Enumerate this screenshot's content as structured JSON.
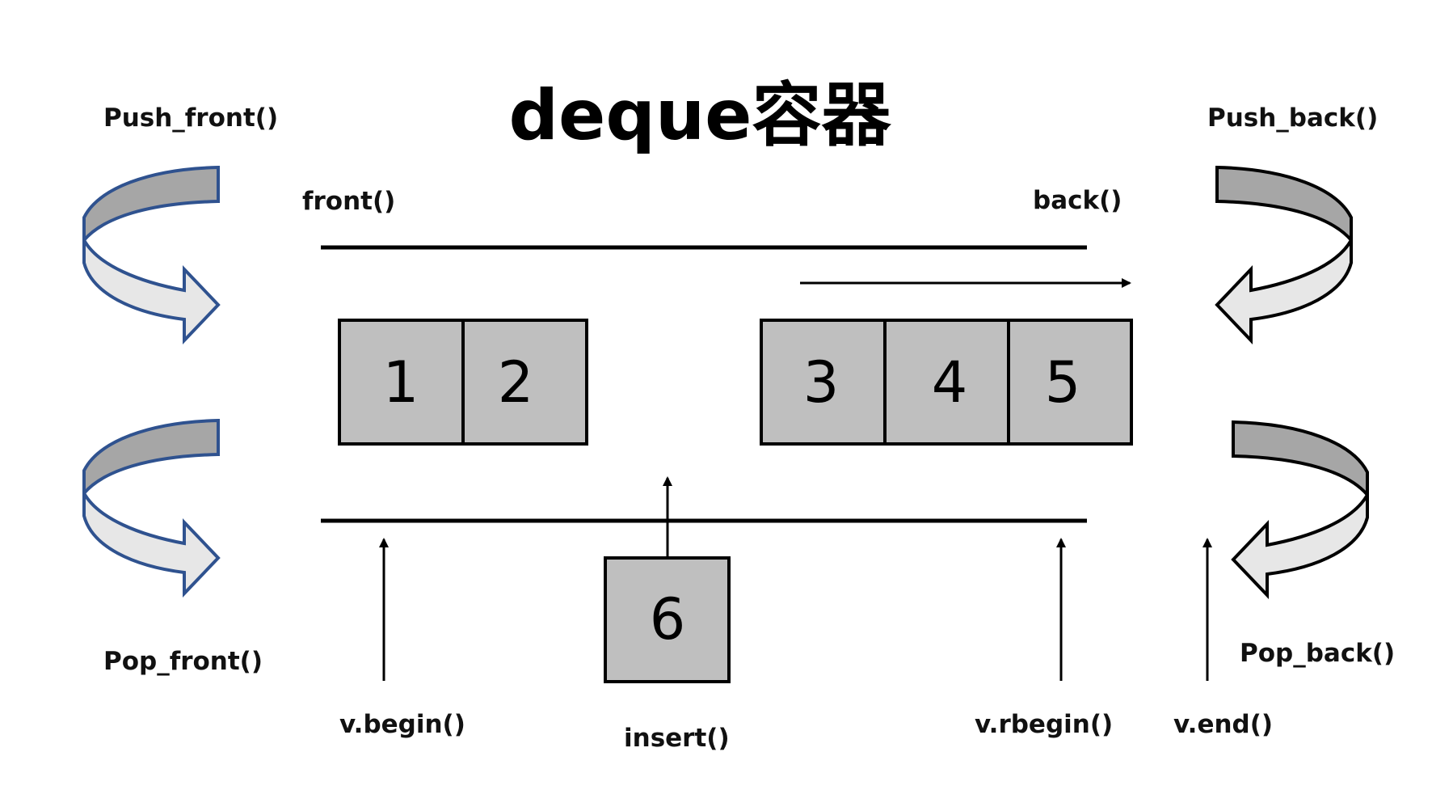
{
  "title": "deque容器",
  "labels": {
    "push_front": "Push_front()",
    "push_back": "Push_back()",
    "pop_front": "Pop_front()",
    "pop_back": "Pop_back()",
    "front": "front()",
    "back": "back()",
    "v_begin": "v.begin()",
    "insert": "insert()",
    "v_rbegin": "v.rbegin()",
    "v_end": "v.end()"
  },
  "cells": {
    "group1": [
      "1",
      "2"
    ],
    "group2": [
      "3",
      "4",
      "5"
    ],
    "inserted": "6"
  },
  "icons": {
    "push_front": "curved-arrow-icon",
    "pop_front": "curved-arrow-icon",
    "push_back": "curved-arrow-icon",
    "pop_back": "curved-arrow-icon"
  },
  "colors": {
    "cell_fill": "#bfbfbf",
    "front_arrow_stroke": "#2f528f",
    "back_arrow_stroke": "#000000",
    "arrow_dark": "#a6a6a6",
    "arrow_light": "#e7e7e7"
  }
}
